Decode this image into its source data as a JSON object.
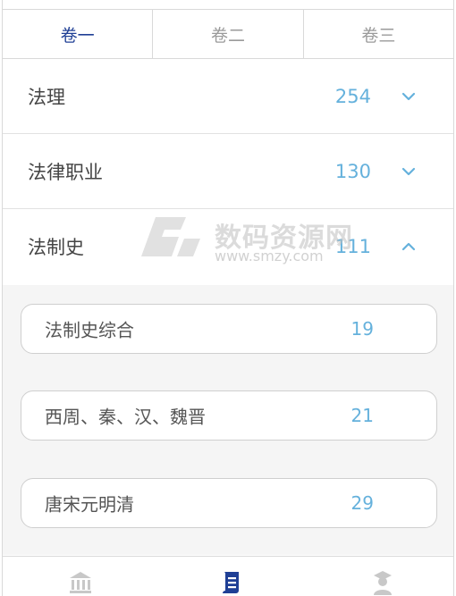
{
  "tabs": [
    {
      "label": "卷一",
      "active": true
    },
    {
      "label": "卷二",
      "active": false
    },
    {
      "label": "卷三",
      "active": false
    }
  ],
  "categories": [
    {
      "name": "法理",
      "count": "254",
      "expanded": false
    },
    {
      "name": "法律职业",
      "count": "130",
      "expanded": false
    },
    {
      "name": "法制史",
      "count": "111",
      "expanded": true
    }
  ],
  "subitems": [
    {
      "name": "法制史综合",
      "count": "19"
    },
    {
      "name": "西周、秦、汉、魏晋",
      "count": "21"
    },
    {
      "name": "唐宋元明清",
      "count": "29"
    }
  ],
  "watermark": {
    "text": "数码资源网",
    "url": "www.smzy.com"
  },
  "bottom_nav": {
    "items": [
      {
        "icon": "bank-icon",
        "active": false
      },
      {
        "icon": "scroll-icon",
        "active": true
      },
      {
        "icon": "user-icon",
        "active": false
      }
    ]
  },
  "colors": {
    "active_tab": "#1f3f95",
    "count": "#65b1dc",
    "nav_active": "#1f3f95",
    "nav_inactive": "#c8c8c8"
  }
}
